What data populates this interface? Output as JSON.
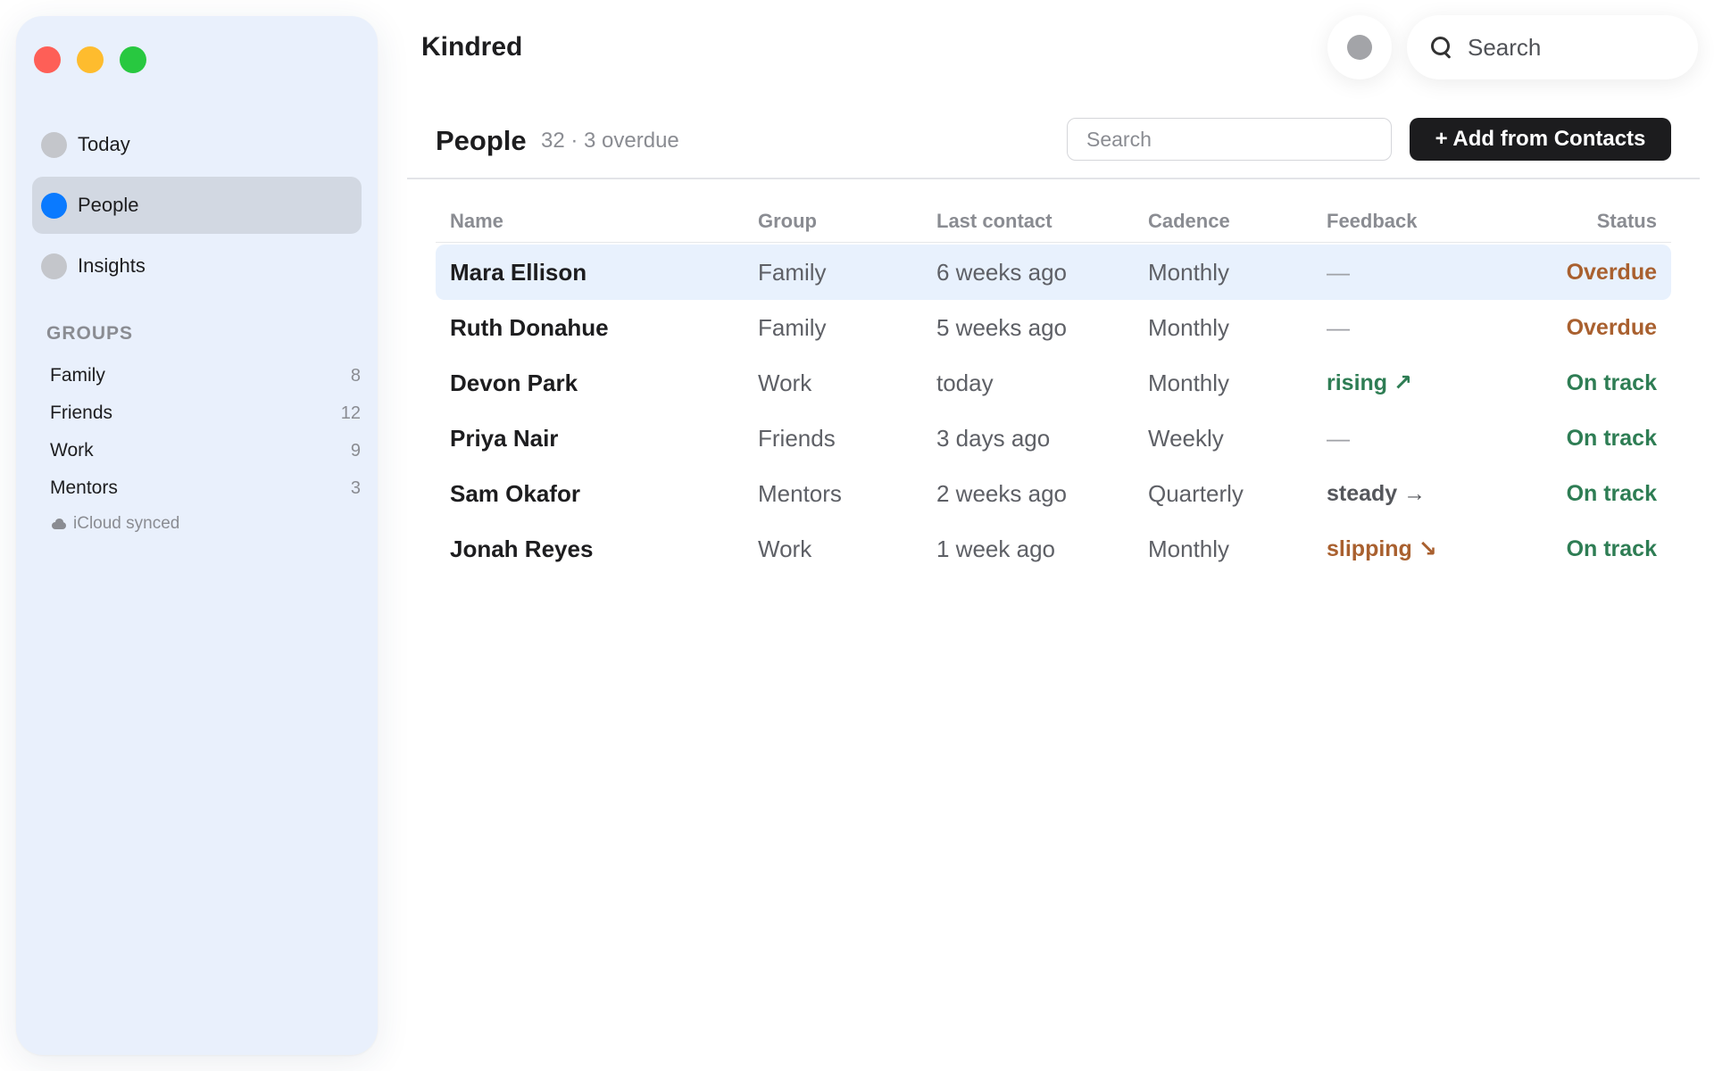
{
  "app": {
    "title": "Kindred"
  },
  "sidebar": {
    "nav": [
      {
        "label": "Today",
        "active": false
      },
      {
        "label": "People",
        "active": true
      },
      {
        "label": "Insights",
        "active": false
      }
    ],
    "groups_title": "GROUPS",
    "groups": [
      {
        "name": "Family",
        "count": "8"
      },
      {
        "name": "Friends",
        "count": "12"
      },
      {
        "name": "Work",
        "count": "9"
      },
      {
        "name": "Mentors",
        "count": "3"
      }
    ],
    "sync_status": "iCloud synced"
  },
  "toolbar": {
    "search_placeholder": "Search"
  },
  "page": {
    "title": "People",
    "subtitle": "32 · 3 overdue",
    "search_placeholder": "Search",
    "add_button_label": "+ Add from Contacts"
  },
  "table": {
    "columns": [
      "Name",
      "Group",
      "Last contact",
      "Cadence",
      "Feedback",
      "Status"
    ],
    "rows": [
      {
        "name": "Mara Ellison",
        "group": "Family",
        "last_contact": "6 weeks ago",
        "cadence": "Monthly",
        "feedback": "—",
        "feedback_kind": "none",
        "status": "Overdue",
        "status_kind": "overdue",
        "selected": true
      },
      {
        "name": "Ruth Donahue",
        "group": "Family",
        "last_contact": "5 weeks ago",
        "cadence": "Monthly",
        "feedback": "—",
        "feedback_kind": "none",
        "status": "Overdue",
        "status_kind": "overdue",
        "selected": false
      },
      {
        "name": "Devon Park",
        "group": "Work",
        "last_contact": "today",
        "cadence": "Monthly",
        "feedback": "rising ↗",
        "feedback_kind": "rising",
        "status": "On track",
        "status_kind": "ontrack",
        "selected": false
      },
      {
        "name": "Priya Nair",
        "group": "Friends",
        "last_contact": "3 days ago",
        "cadence": "Weekly",
        "feedback": "—",
        "feedback_kind": "none",
        "status": "On track",
        "status_kind": "ontrack",
        "selected": false
      },
      {
        "name": "Sam Okafor",
        "group": "Mentors",
        "last_contact": "2 weeks ago",
        "cadence": "Quarterly",
        "feedback": "steady →",
        "feedback_kind": "steady",
        "status": "On track",
        "status_kind": "ontrack",
        "selected": false
      },
      {
        "name": "Jonah Reyes",
        "group": "Work",
        "last_contact": "1 week ago",
        "cadence": "Monthly",
        "feedback": "slipping ↘",
        "feedback_kind": "slipping",
        "status": "On track",
        "status_kind": "ontrack",
        "selected": false
      }
    ]
  },
  "colors": {
    "accent": "#0a7aff",
    "sidebar_bg": "#e9f0fc",
    "selected_row": "#e8f1fd",
    "overdue": "#a9602f",
    "on_track": "#2e7d54",
    "button_dark": "#1c1c1e"
  }
}
